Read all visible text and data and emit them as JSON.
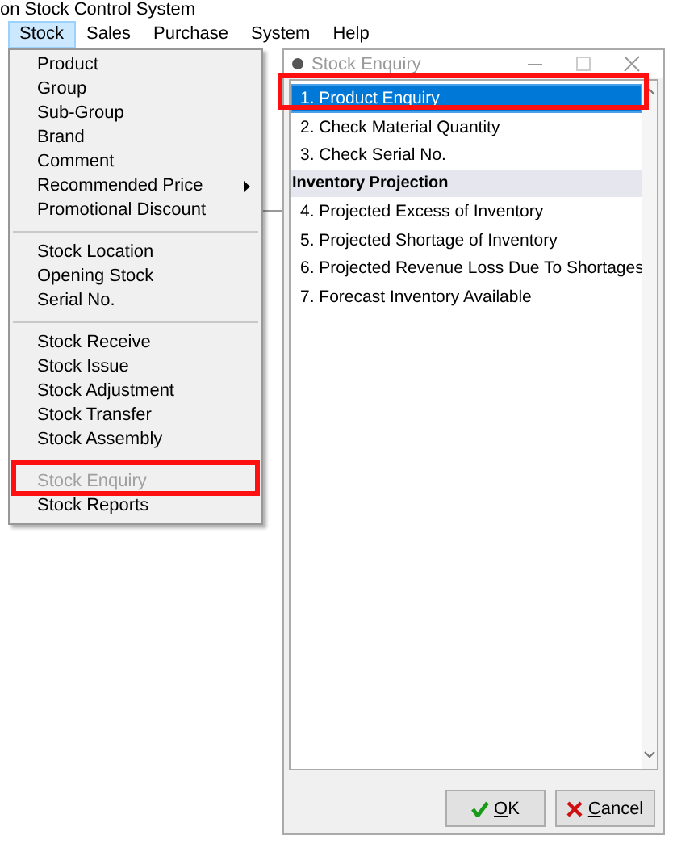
{
  "window": {
    "title": "on Stock Control System"
  },
  "menu_bar": [
    {
      "label": "Stock",
      "selected": true
    },
    {
      "label": "Sales",
      "selected": false
    },
    {
      "label": "Purchase",
      "selected": false
    },
    {
      "label": "System",
      "selected": false
    },
    {
      "label": "Help",
      "selected": false
    }
  ],
  "stock_menu": [
    {
      "kind": "item",
      "label": "Product",
      "disabled": false,
      "submenu": false,
      "annotated": false
    },
    {
      "kind": "item",
      "label": "Group",
      "disabled": false,
      "submenu": false,
      "annotated": false
    },
    {
      "kind": "item",
      "label": "Sub-Group",
      "disabled": false,
      "submenu": false,
      "annotated": false
    },
    {
      "kind": "item",
      "label": "Brand",
      "disabled": false,
      "submenu": false,
      "annotated": false
    },
    {
      "kind": "item",
      "label": "Comment",
      "disabled": false,
      "submenu": false,
      "annotated": false
    },
    {
      "kind": "item",
      "label": "Recommended Price",
      "disabled": false,
      "submenu": true,
      "annotated": false
    },
    {
      "kind": "item",
      "label": "Promotional Discount",
      "disabled": false,
      "submenu": false,
      "annotated": false
    },
    {
      "kind": "separator"
    },
    {
      "kind": "item",
      "label": "Stock Location",
      "disabled": false,
      "submenu": false,
      "annotated": false
    },
    {
      "kind": "item",
      "label": "Opening Stock",
      "disabled": false,
      "submenu": false,
      "annotated": false
    },
    {
      "kind": "item",
      "label": "Serial No.",
      "disabled": false,
      "submenu": false,
      "annotated": false
    },
    {
      "kind": "separator"
    },
    {
      "kind": "item",
      "label": "Stock Receive",
      "disabled": false,
      "submenu": false,
      "annotated": false
    },
    {
      "kind": "item",
      "label": "Stock Issue",
      "disabled": false,
      "submenu": false,
      "annotated": false
    },
    {
      "kind": "item",
      "label": "Stock Adjustment",
      "disabled": false,
      "submenu": false,
      "annotated": false
    },
    {
      "kind": "item",
      "label": "Stock Transfer",
      "disabled": false,
      "submenu": false,
      "annotated": false
    },
    {
      "kind": "item",
      "label": "Stock Assembly",
      "disabled": false,
      "submenu": false,
      "annotated": false
    },
    {
      "kind": "separator"
    },
    {
      "kind": "item",
      "label": "Stock Enquiry",
      "disabled": true,
      "submenu": false,
      "annotated": true
    },
    {
      "kind": "item",
      "label": "Stock Reports",
      "disabled": false,
      "submenu": false,
      "annotated": false
    }
  ],
  "dialog": {
    "title": "Stock Enquiry",
    "list": [
      {
        "kind": "option",
        "label": "1. Product Enquiry",
        "selected": true,
        "annotated": true
      },
      {
        "kind": "option",
        "label": "2. Check Material Quantity",
        "selected": false,
        "annotated": false
      },
      {
        "kind": "option",
        "label": "3. Check Serial No.",
        "selected": false,
        "annotated": false
      },
      {
        "kind": "group",
        "label": "Inventory Projection"
      },
      {
        "kind": "option",
        "label": "4. Projected Excess of Inventory",
        "selected": false,
        "annotated": false
      },
      {
        "kind": "option",
        "label": "5. Projected Shortage of Inventory",
        "selected": false,
        "annotated": false
      },
      {
        "kind": "option",
        "label": "6. Projected Revenue Loss Due To Shortages",
        "selected": false,
        "annotated": false
      },
      {
        "kind": "option",
        "label": "7. Forecast Inventory Available",
        "selected": false,
        "annotated": false
      }
    ],
    "buttons": [
      {
        "kind": "ok",
        "label": "OK"
      },
      {
        "kind": "cancel",
        "label": "Cancel"
      }
    ]
  }
}
